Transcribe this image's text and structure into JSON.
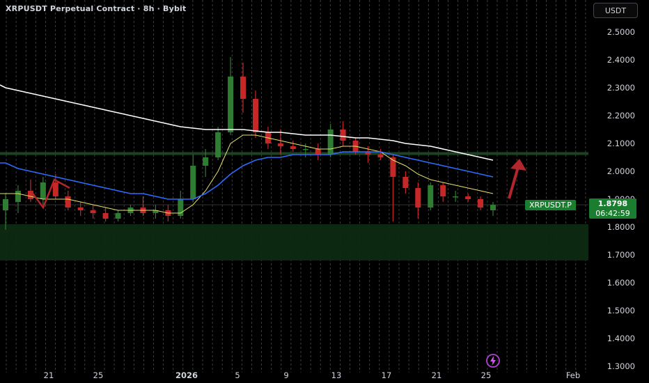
{
  "header": {
    "title": "XRPUSDT Perpetual Contract · 8h · Bybit",
    "currency_button": "USDT"
  },
  "last_price": {
    "symbol_label": "XRPUSDT.P",
    "price": "1.8798",
    "countdown": "06:42:59"
  },
  "colors": {
    "background": "#000000",
    "up": "#26a69a",
    "up_candle": "#2e7d32",
    "down_candle": "#c62828",
    "ma_fast": "#e8e26b",
    "ma_mid": "#2f6bff",
    "ma_slow": "#ffffff",
    "zone": "#0d2a12",
    "price_tag": "#1b7d2f",
    "arrow": "#b3262c"
  },
  "chart_data": {
    "type": "candlestick",
    "title": "XRPUSDT Perpetual Contract · 8h · Bybit",
    "y_axis": {
      "ticks": [
        "2.5000",
        "2.4000",
        "2.3000",
        "2.2000",
        "2.1000",
        "2.0000",
        "1.9000",
        "1.8000",
        "1.7000",
        "1.6000",
        "1.5000",
        "1.4000",
        "1.3000"
      ],
      "ylim": [
        1.3,
        2.6
      ],
      "side": "right"
    },
    "x_axis": {
      "ticks": [
        "21",
        "25",
        "2026",
        "5",
        "9",
        "13",
        "17",
        "21",
        "25",
        "Feb"
      ]
    },
    "grid": "vertical dashed",
    "candles": [
      {
        "x": "Dec 18",
        "o": 1.86,
        "h": 1.92,
        "l": 1.79,
        "c": 1.9
      },
      {
        "x": "Dec 19",
        "o": 1.89,
        "h": 1.95,
        "l": 1.85,
        "c": 1.93
      },
      {
        "x": "Dec 20",
        "o": 1.93,
        "h": 1.97,
        "l": 1.89,
        "c": 1.9
      },
      {
        "x": "Dec 21",
        "o": 1.9,
        "h": 1.98,
        "l": 1.88,
        "c": 1.96
      },
      {
        "x": "Dec 22",
        "o": 1.96,
        "h": 1.99,
        "l": 1.9,
        "c": 1.91
      },
      {
        "x": "Dec 23",
        "o": 1.91,
        "h": 1.93,
        "l": 1.86,
        "c": 1.87
      },
      {
        "x": "Dec 24",
        "o": 1.87,
        "h": 1.89,
        "l": 1.84,
        "c": 1.86
      },
      {
        "x": "Dec 25",
        "o": 1.86,
        "h": 1.88,
        "l": 1.83,
        "c": 1.85
      },
      {
        "x": "Dec 26",
        "o": 1.85,
        "h": 1.87,
        "l": 1.82,
        "c": 1.83
      },
      {
        "x": "Dec 27",
        "o": 1.83,
        "h": 1.86,
        "l": 1.82,
        "c": 1.85
      },
      {
        "x": "Dec 28",
        "o": 1.85,
        "h": 1.88,
        "l": 1.84,
        "c": 1.87
      },
      {
        "x": "Dec 29",
        "o": 1.87,
        "h": 1.91,
        "l": 1.84,
        "c": 1.85
      },
      {
        "x": "Dec 30",
        "o": 1.85,
        "h": 1.88,
        "l": 1.83,
        "c": 1.86
      },
      {
        "x": "Dec 31",
        "o": 1.86,
        "h": 1.88,
        "l": 1.82,
        "c": 1.84
      },
      {
        "x": "Jan 01",
        "o": 1.84,
        "h": 1.93,
        "l": 1.83,
        "c": 1.9
      },
      {
        "x": "Jan 02",
        "o": 1.9,
        "h": 2.06,
        "l": 1.89,
        "c": 2.02
      },
      {
        "x": "Jan 03",
        "o": 2.02,
        "h": 2.08,
        "l": 1.98,
        "c": 2.05
      },
      {
        "x": "Jan 04",
        "o": 2.05,
        "h": 2.16,
        "l": 2.04,
        "c": 2.14
      },
      {
        "x": "Jan 05",
        "o": 2.14,
        "h": 2.41,
        "l": 2.13,
        "c": 2.34
      },
      {
        "x": "Jan 06",
        "o": 2.34,
        "h": 2.39,
        "l": 2.21,
        "c": 2.26
      },
      {
        "x": "Jan 07",
        "o": 2.26,
        "h": 2.29,
        "l": 2.12,
        "c": 2.14
      },
      {
        "x": "Jan 08",
        "o": 2.14,
        "h": 2.16,
        "l": 2.08,
        "c": 2.1
      },
      {
        "x": "Jan 09",
        "o": 2.1,
        "h": 2.15,
        "l": 2.06,
        "c": 2.09
      },
      {
        "x": "Jan 10",
        "o": 2.09,
        "h": 2.11,
        "l": 2.07,
        "c": 2.08
      },
      {
        "x": "Jan 11",
        "o": 2.08,
        "h": 2.1,
        "l": 2.05,
        "c": 2.08
      },
      {
        "x": "Jan 12",
        "o": 2.08,
        "h": 2.1,
        "l": 2.04,
        "c": 2.06
      },
      {
        "x": "Jan 13",
        "o": 2.06,
        "h": 2.17,
        "l": 2.05,
        "c": 2.15
      },
      {
        "x": "Jan 14",
        "o": 2.15,
        "h": 2.18,
        "l": 2.09,
        "c": 2.11
      },
      {
        "x": "Jan 15",
        "o": 2.11,
        "h": 2.12,
        "l": 2.06,
        "c": 2.07
      },
      {
        "x": "Jan 16",
        "o": 2.07,
        "h": 2.09,
        "l": 2.03,
        "c": 2.06
      },
      {
        "x": "Jan 17",
        "o": 2.06,
        "h": 2.08,
        "l": 2.04,
        "c": 2.05
      },
      {
        "x": "Jan 18",
        "o": 2.05,
        "h": 2.06,
        "l": 1.82,
        "c": 1.98
      },
      {
        "x": "Jan 19",
        "o": 1.98,
        "h": 2.0,
        "l": 1.92,
        "c": 1.94
      },
      {
        "x": "Jan 20",
        "o": 1.94,
        "h": 1.96,
        "l": 1.83,
        "c": 1.87
      },
      {
        "x": "Jan 21",
        "o": 1.87,
        "h": 1.96,
        "l": 1.86,
        "c": 1.95
      },
      {
        "x": "Jan 22",
        "o": 1.95,
        "h": 1.96,
        "l": 1.89,
        "c": 1.91
      },
      {
        "x": "Jan 23",
        "o": 1.91,
        "h": 1.93,
        "l": 1.89,
        "c": 1.91
      },
      {
        "x": "Jan 24",
        "o": 1.91,
        "h": 1.92,
        "l": 1.89,
        "c": 1.9
      },
      {
        "x": "Jan 25",
        "o": 1.9,
        "h": 1.91,
        "l": 1.86,
        "c": 1.87
      },
      {
        "x": "Jan 26",
        "o": 1.86,
        "h": 1.89,
        "l": 1.84,
        "c": 1.8798
      }
    ],
    "moving_averages": [
      {
        "color": "#e8e26b",
        "values": [
          1.92,
          1.92,
          1.91,
          1.9,
          1.9,
          1.9,
          1.89,
          1.88,
          1.87,
          1.86,
          1.86,
          1.86,
          1.86,
          1.85,
          1.85,
          1.88,
          1.93,
          2.0,
          2.1,
          2.13,
          2.13,
          2.12,
          2.11,
          2.1,
          2.09,
          2.08,
          2.08,
          2.09,
          2.09,
          2.08,
          2.07,
          2.04,
          2.02,
          1.99,
          1.97,
          1.96,
          1.95,
          1.94,
          1.93,
          1.92
        ]
      },
      {
        "color": "#2f6bff",
        "values": [
          2.03,
          2.01,
          2.0,
          1.99,
          1.98,
          1.97,
          1.96,
          1.95,
          1.94,
          1.93,
          1.92,
          1.92,
          1.91,
          1.9,
          1.9,
          1.9,
          1.92,
          1.95,
          1.99,
          2.02,
          2.04,
          2.05,
          2.05,
          2.06,
          2.06,
          2.06,
          2.06,
          2.07,
          2.07,
          2.07,
          2.07,
          2.06,
          2.05,
          2.04,
          2.03,
          2.02,
          2.01,
          2.0,
          1.99,
          1.98
        ]
      },
      {
        "color": "#ffffff",
        "values": [
          2.3,
          2.29,
          2.28,
          2.27,
          2.26,
          2.25,
          2.24,
          2.23,
          2.22,
          2.21,
          2.2,
          2.19,
          2.18,
          2.17,
          2.16,
          2.155,
          2.15,
          2.15,
          2.15,
          2.15,
          2.145,
          2.14,
          2.14,
          2.135,
          2.13,
          2.13,
          2.13,
          2.125,
          2.12,
          2.12,
          2.115,
          2.11,
          2.1,
          2.095,
          2.09,
          2.08,
          2.07,
          2.06,
          2.05,
          2.04
        ]
      }
    ],
    "support_zone": {
      "low": 1.68,
      "high": 1.81
    },
    "resistance_line": 2.065
  }
}
